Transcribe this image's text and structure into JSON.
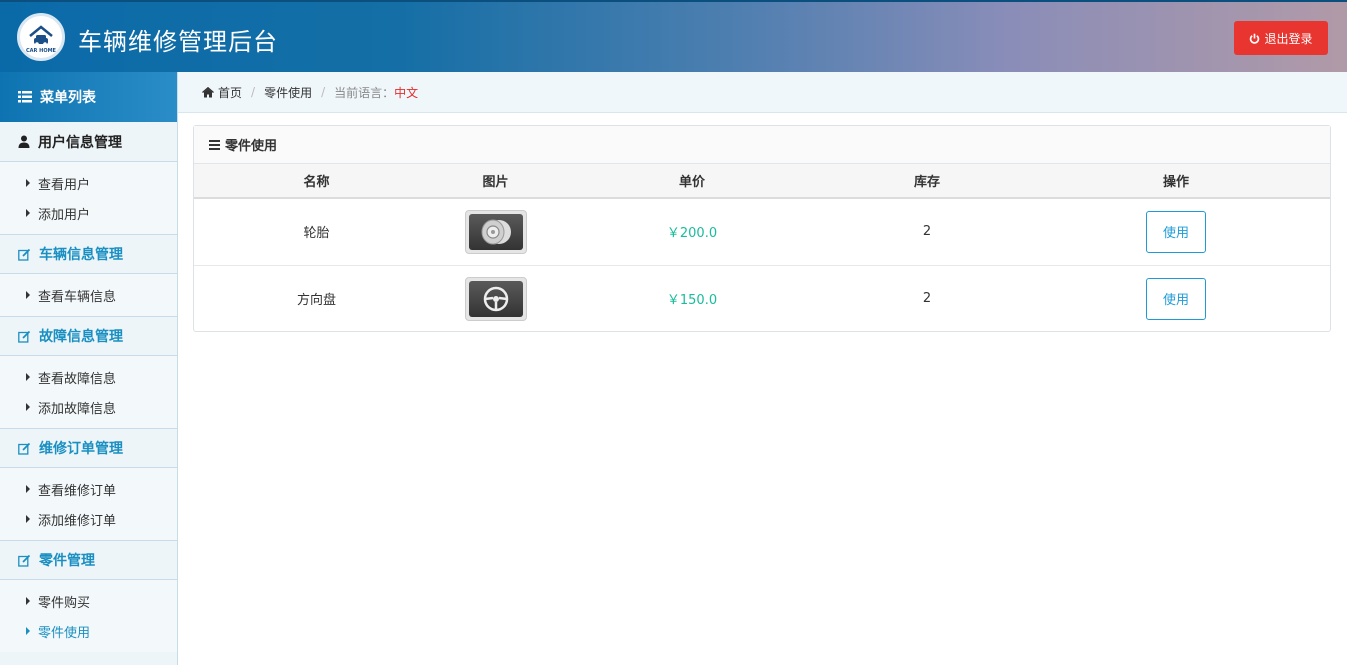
{
  "header": {
    "logo_text": "CAR HOME",
    "title": "车辆维修管理后台",
    "logout_label": "退出登录"
  },
  "sidebar": {
    "title": "菜单列表",
    "groups": [
      {
        "title": "用户信息管理",
        "items": [
          "查看用户",
          "添加用户"
        ]
      },
      {
        "title": "车辆信息管理",
        "items": [
          "查看车辆信息"
        ]
      },
      {
        "title": "故障信息管理",
        "items": [
          "查看故障信息",
          "添加故障信息"
        ]
      },
      {
        "title": "维修订单管理",
        "items": [
          "查看维修订单",
          "添加维修订单"
        ]
      },
      {
        "title": "零件管理",
        "items": [
          "零件购买",
          "零件使用"
        ]
      }
    ]
  },
  "breadcrumb": {
    "home": "首页",
    "current": "零件使用",
    "lang_label": "当前语言：",
    "lang_value": "中文"
  },
  "panel": {
    "title": "零件使用",
    "columns": [
      "名称",
      "图片",
      "单价",
      "库存",
      "操作"
    ],
    "rows": [
      {
        "name": "轮胎",
        "image": "tire-image",
        "price": "￥200.0",
        "stock": "2",
        "action": "使用"
      },
      {
        "name": "方向盘",
        "image": "steering-wheel-image",
        "price": "￥150.0",
        "stock": "2",
        "action": "使用"
      }
    ]
  },
  "colors": {
    "accent": "#1a8fc1",
    "price": "#1abc9c",
    "logout": "#e8352f",
    "lang_value": "#e52b2b"
  }
}
